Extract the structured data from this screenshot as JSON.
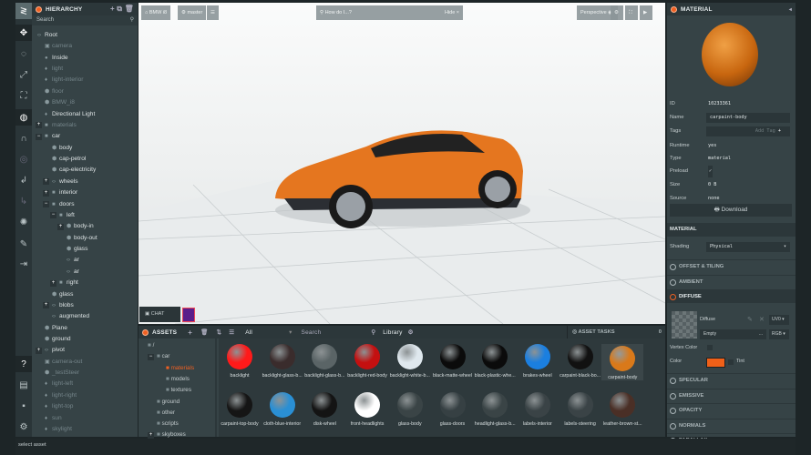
{
  "toolbar": {
    "tools": [
      "logo",
      "translate-icon",
      "rotate-icon",
      "scale-icon",
      "resize-icon",
      "world-icon",
      "magnet-icon",
      "focus-icon",
      "undo-icon",
      "redo-icon",
      "light-icon",
      "edit-icon",
      "publish-icon"
    ],
    "bottom": [
      "help-icon",
      "console-icon",
      "chat-icon",
      "settings-icon"
    ]
  },
  "hierarchy": {
    "title": "HIERARCHY",
    "search_placeholder": "Search",
    "items": [
      {
        "label": "Root",
        "depth": 0,
        "dim": false,
        "icon": "‹›",
        "toggle": ""
      },
      {
        "label": "camera",
        "depth": 1,
        "dim": true,
        "icon": "▣",
        "toggle": ""
      },
      {
        "label": "Inside",
        "depth": 1,
        "dim": false,
        "icon": "●",
        "toggle": ""
      },
      {
        "label": "light",
        "depth": 1,
        "dim": true,
        "icon": "♦",
        "toggle": ""
      },
      {
        "label": "light-interior",
        "depth": 1,
        "dim": true,
        "icon": "♦",
        "toggle": ""
      },
      {
        "label": "floor",
        "depth": 1,
        "dim": true,
        "icon": "⬢",
        "toggle": ""
      },
      {
        "label": "BMW_i8",
        "depth": 1,
        "dim": true,
        "icon": "⬢",
        "toggle": ""
      },
      {
        "label": "Directional Light",
        "depth": 1,
        "dim": false,
        "icon": "♦",
        "toggle": ""
      },
      {
        "label": "materials",
        "depth": 1,
        "dim": true,
        "icon": "■",
        "toggle": "+"
      },
      {
        "label": "car",
        "depth": 1,
        "dim": false,
        "icon": "■",
        "toggle": "−"
      },
      {
        "label": "body",
        "depth": 2,
        "dim": false,
        "icon": "⬢",
        "toggle": ""
      },
      {
        "label": "cap-petrol",
        "depth": 2,
        "dim": false,
        "icon": "⬢",
        "toggle": ""
      },
      {
        "label": "cap-electricity",
        "depth": 2,
        "dim": false,
        "icon": "⬢",
        "toggle": ""
      },
      {
        "label": "wheels",
        "depth": 2,
        "dim": false,
        "icon": "‹›",
        "toggle": "+"
      },
      {
        "label": "interior",
        "depth": 2,
        "dim": false,
        "icon": "■",
        "toggle": "+"
      },
      {
        "label": "doors",
        "depth": 2,
        "dim": false,
        "icon": "■",
        "toggle": "−"
      },
      {
        "label": "left",
        "depth": 3,
        "dim": false,
        "icon": "■",
        "toggle": "−"
      },
      {
        "label": "body-in",
        "depth": 4,
        "dim": false,
        "icon": "⬢",
        "toggle": "+"
      },
      {
        "label": "body-out",
        "depth": 4,
        "dim": false,
        "icon": "⬢",
        "toggle": ""
      },
      {
        "label": "glass",
        "depth": 4,
        "dim": false,
        "icon": "⬢",
        "toggle": ""
      },
      {
        "label": "ar",
        "depth": 4,
        "dim": false,
        "icon": "‹›",
        "toggle": ""
      },
      {
        "label": "ar",
        "depth": 4,
        "dim": false,
        "icon": "‹›",
        "toggle": ""
      },
      {
        "label": "right",
        "depth": 3,
        "dim": false,
        "icon": "■",
        "toggle": "+"
      },
      {
        "label": "glass",
        "depth": 2,
        "dim": false,
        "icon": "⬢",
        "toggle": ""
      },
      {
        "label": "blobs",
        "depth": 2,
        "dim": false,
        "icon": "‹›",
        "toggle": "+"
      },
      {
        "label": "augmented",
        "depth": 2,
        "dim": false,
        "icon": "‹›",
        "toggle": ""
      },
      {
        "label": "Plane",
        "depth": 1,
        "dim": false,
        "icon": "⬢",
        "toggle": ""
      },
      {
        "label": "ground",
        "depth": 1,
        "dim": false,
        "icon": "⬢",
        "toggle": ""
      },
      {
        "label": "pivot",
        "depth": 1,
        "dim": false,
        "icon": "‹›",
        "toggle": "+"
      },
      {
        "label": "camera-out",
        "depth": 1,
        "dim": true,
        "icon": "▣",
        "toggle": ""
      },
      {
        "label": "_testSteer",
        "depth": 1,
        "dim": true,
        "icon": "⬢",
        "toggle": ""
      },
      {
        "label": "light-left",
        "depth": 1,
        "dim": true,
        "icon": "♦",
        "toggle": ""
      },
      {
        "label": "light-right",
        "depth": 1,
        "dim": true,
        "icon": "♦",
        "toggle": ""
      },
      {
        "label": "light-top",
        "depth": 1,
        "dim": true,
        "icon": "♦",
        "toggle": ""
      },
      {
        "label": "sun",
        "depth": 1,
        "dim": true,
        "icon": "♦",
        "toggle": ""
      },
      {
        "label": "skylight",
        "depth": 1,
        "dim": true,
        "icon": "♦",
        "toggle": ""
      }
    ]
  },
  "viewport": {
    "project": "BMW i8",
    "branch": "master",
    "search_placeholder": "How do I...?",
    "hide_label": "Hide ×",
    "camera": "Perspective",
    "chat_label": "CHAT"
  },
  "assets": {
    "title": "ASSETS",
    "filter": "All",
    "search_placeholder": "Search",
    "library": "Library",
    "tasks_title": "ASSET TASKS",
    "tasks_count": "0",
    "folders": [
      {
        "label": "/",
        "depth": 0,
        "toggle": "",
        "selected": false
      },
      {
        "label": "car",
        "depth": 1,
        "toggle": "−",
        "selected": false
      },
      {
        "label": "materials",
        "depth": 2,
        "toggle": "",
        "selected": true
      },
      {
        "label": "models",
        "depth": 2,
        "toggle": "",
        "selected": false
      },
      {
        "label": "textures",
        "depth": 2,
        "toggle": "",
        "selected": false
      },
      {
        "label": "ground",
        "depth": 1,
        "toggle": "",
        "selected": false
      },
      {
        "label": "other",
        "depth": 1,
        "toggle": "",
        "selected": false
      },
      {
        "label": "scripts",
        "depth": 1,
        "toggle": "",
        "selected": false
      },
      {
        "label": "skyboxes",
        "depth": 1,
        "toggle": "+",
        "selected": false
      }
    ],
    "items": [
      {
        "label": "backlight",
        "color": "#ff1a1a"
      },
      {
        "label": "backlight-glass-b...",
        "color": "#3a2c2c"
      },
      {
        "label": "backlight-glass-b...",
        "color": "#5a6466"
      },
      {
        "label": "backlight-red-body",
        "color": "#c41010"
      },
      {
        "label": "backlight-white-b...",
        "color": "#dfe8ee"
      },
      {
        "label": "black-matte-wheel",
        "color": "#0b0b0b"
      },
      {
        "label": "black-plastic-whe...",
        "color": "#0b0b0b"
      },
      {
        "label": "brakes-wheel",
        "color": "#1b7fe0"
      },
      {
        "label": "carpaint-black-bo...",
        "color": "#111111"
      },
      {
        "label": "carpaint-body",
        "color": "#d9791a"
      },
      {
        "label": "carpaint-top-body",
        "color": "#151515"
      },
      {
        "label": "cloth-blue-interior",
        "color": "#2a8fd4"
      },
      {
        "label": "disk-wheel",
        "color": "#141414"
      },
      {
        "label": "front-headlights",
        "color": "#ffffff"
      },
      {
        "label": "glass-body",
        "color": "#3a4446"
      },
      {
        "label": "glass-doors",
        "color": "#364043"
      },
      {
        "label": "headlight-glass-b...",
        "color": "#3a4446"
      },
      {
        "label": "labels-interior",
        "color": "#3a4346"
      },
      {
        "label": "labels-steering",
        "color": "#3a4346"
      },
      {
        "label": "leather-brown-st...",
        "color": "#4a2f26"
      }
    ]
  },
  "inspector": {
    "title": "MATERIAL",
    "fields": [
      {
        "label": "ID",
        "value": "10233361"
      },
      {
        "label": "Name",
        "value": "carpaint-body"
      },
      {
        "label": "Tags",
        "value": "Add Tag"
      },
      {
        "label": "Runtime",
        "value": "yes"
      },
      {
        "label": "Type",
        "value": "material"
      },
      {
        "label": "Preload",
        "value": "✓"
      },
      {
        "label": "Size",
        "value": "0 B"
      },
      {
        "label": "Source",
        "value": "none"
      }
    ],
    "download": "Download",
    "material_section": "MATERIAL",
    "shading_label": "Shading",
    "shading_value": "Physical",
    "sections_a": [
      "OFFSET & TILING",
      "AMBIENT"
    ],
    "diffuse": "DIFFUSE",
    "diffuse_label": "Diffuse",
    "diffuse_empty": "Empty",
    "uv": "UV0",
    "channel": "RGB",
    "vertex_color": "Vertex Color",
    "color_label": "Color",
    "tint": "Tint",
    "diffuse_color": "#f06018",
    "sections_b": [
      "SPECULAR",
      "EMISSIVE",
      "OPACITY",
      "NORMALS",
      "PARALLAX"
    ]
  },
  "status": {
    "text": "select asset"
  },
  "colors": {
    "accent": "#f06022",
    "panel": "#364346"
  }
}
